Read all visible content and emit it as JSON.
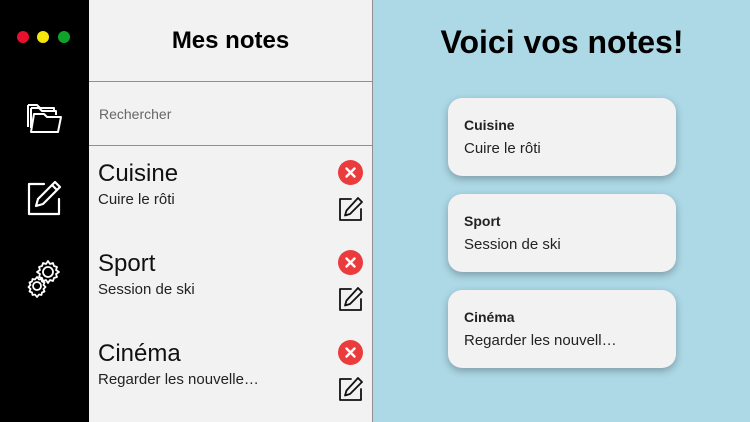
{
  "window": {
    "controls": [
      "close",
      "minimize",
      "maximize"
    ]
  },
  "sidebar": {
    "icons": [
      "folder-icon",
      "edit-note-icon",
      "settings-gears-icon"
    ]
  },
  "list": {
    "title": "Mes notes",
    "search_placeholder": "Rechercher",
    "items": [
      {
        "title": "Cuisine",
        "body": "Cuire le rôti"
      },
      {
        "title": "Sport",
        "body": "Session de ski"
      },
      {
        "title": "Cinéma",
        "body": "Regarder les nouvelle…"
      }
    ]
  },
  "main": {
    "title": "Voici vos notes!",
    "cards": [
      {
        "title": "Cuisine",
        "body": "Cuire le rôti"
      },
      {
        "title": "Sport",
        "body": "Session de ski"
      },
      {
        "title": "Cinéma",
        "body": "Regarder les nouvell…"
      }
    ]
  },
  "colors": {
    "rail": "#000000",
    "list_bg": "#f2f2f2",
    "main_bg": "#add8e6",
    "delete": "#ea3c3c",
    "dot_red": "#e8102e",
    "dot_yellow": "#f5e60c",
    "dot_green": "#10a32a"
  }
}
